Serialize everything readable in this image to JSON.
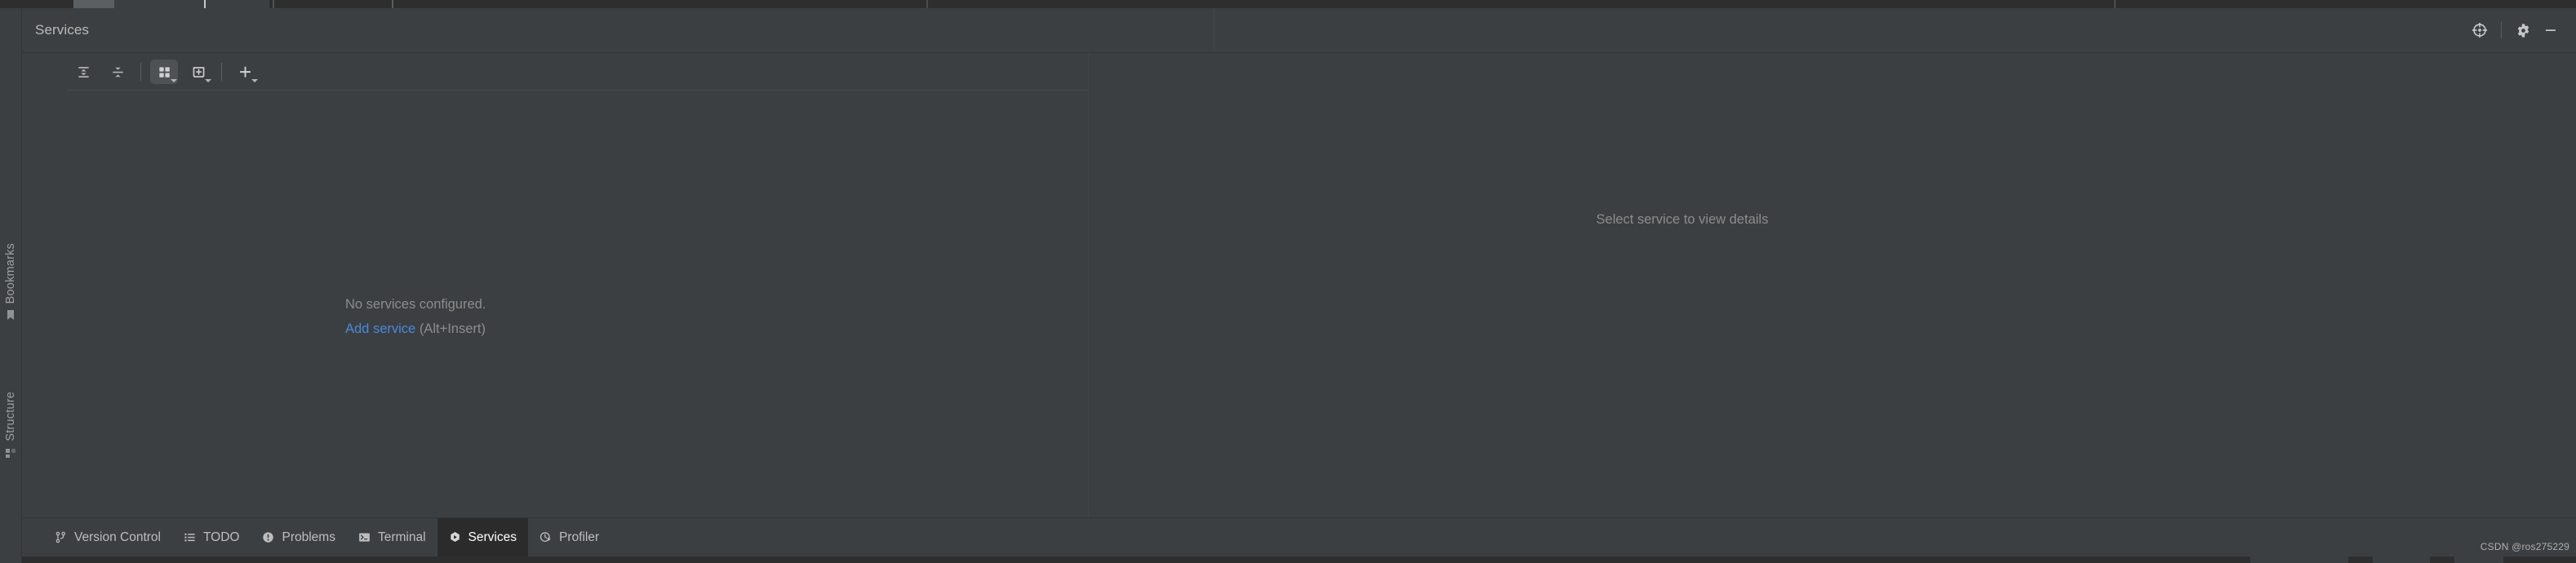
{
  "window": {
    "title": "Services"
  },
  "header": {
    "title": "Services",
    "actions": [
      {
        "name": "locate-icon",
        "label": "Locate"
      },
      {
        "name": "settings-gear-icon",
        "label": "Settings"
      },
      {
        "name": "minimize-icon",
        "label": "Hide"
      }
    ]
  },
  "left_rail": {
    "items": [
      {
        "label": "Bookmarks",
        "icon": "bookmark-icon"
      },
      {
        "label": "Structure",
        "icon": "structure-icon"
      }
    ]
  },
  "toolbar": {
    "buttons": [
      {
        "name": "expand-all-button",
        "icon": "expand-all-icon",
        "label": "Expand All",
        "active": false,
        "caret": false
      },
      {
        "name": "collapse-all-button",
        "icon": "collapse-all-icon",
        "label": "Collapse All",
        "active": false,
        "caret": false
      },
      {
        "name": "group-by-button",
        "icon": "group-by-icon",
        "label": "Group By",
        "active": true,
        "caret": true
      },
      {
        "name": "add-tab-button",
        "icon": "add-tab-icon",
        "label": "Add Tab",
        "active": false,
        "caret": true
      },
      {
        "name": "add-service-button",
        "icon": "plus-icon",
        "label": "Add Service",
        "active": false,
        "caret": true
      }
    ]
  },
  "left_pane": {
    "empty_message": "No services configured.",
    "add_link": "Add service",
    "add_shortcut": "(Alt+Insert)"
  },
  "right_pane": {
    "empty_message": "Select service to view details"
  },
  "bottom_tabs": [
    {
      "label": "Version Control",
      "icon": "branch-icon",
      "selected": false
    },
    {
      "label": "TODO",
      "icon": "list-icon",
      "selected": false
    },
    {
      "label": "Problems",
      "icon": "warning-icon",
      "selected": false
    },
    {
      "label": "Terminal",
      "icon": "terminal-icon",
      "selected": false
    },
    {
      "label": "Services",
      "icon": "services-play-icon",
      "selected": true
    },
    {
      "label": "Profiler",
      "icon": "profiler-icon",
      "selected": false
    }
  ],
  "watermark": "CSDN @ros275229",
  "colors": {
    "background": "#3c3f41",
    "selected_tab_background": "#2b2b2b",
    "link": "#4a88dd",
    "muted_text": "#8c8c8c",
    "text": "#bbbbbb"
  }
}
